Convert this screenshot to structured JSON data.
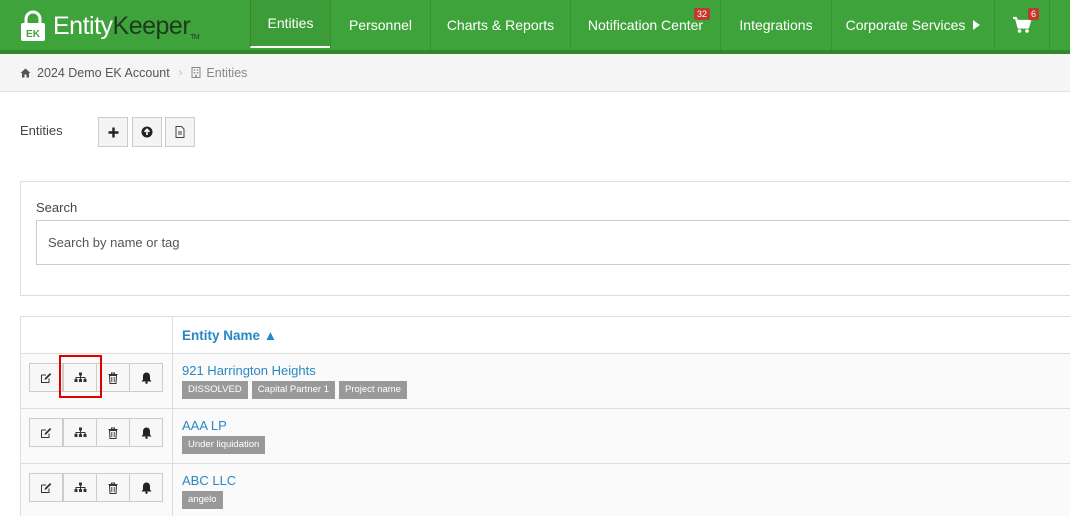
{
  "app": {
    "logo_part1": "Entity",
    "logo_part2": "Keeper",
    "logo_tm": "TM"
  },
  "nav": {
    "items": [
      {
        "label": "Entities",
        "active": true
      },
      {
        "label": "Personnel"
      },
      {
        "label": "Charts & Reports"
      },
      {
        "label": "Notification Center",
        "badge": "32"
      },
      {
        "label": "Integrations"
      },
      {
        "label": "Corporate Services"
      }
    ],
    "cart_badge": "6"
  },
  "breadcrumb": {
    "account": "2024 Demo EK Account",
    "current": "Entities"
  },
  "entities_header": {
    "title": "Entities"
  },
  "search": {
    "label": "Search",
    "placeholder": "Search by name or tag"
  },
  "table": {
    "header_name": "Entity Name ▲",
    "rows": [
      {
        "name": "921 Harrington Heights",
        "tags": [
          "DISSOLVED",
          "Capital Partner 1",
          "Project name"
        ]
      },
      {
        "name": "AAA LP",
        "tags": [
          "Under liquidation"
        ]
      },
      {
        "name": "ABC LLC",
        "tags": [
          "angelo"
        ]
      }
    ]
  },
  "colors": {
    "brand_green": "#3fa33b",
    "link_blue": "#2a87c4",
    "badge_red": "#c0392b",
    "tag_gray": "#999999",
    "highlight_red": "#e00000"
  }
}
